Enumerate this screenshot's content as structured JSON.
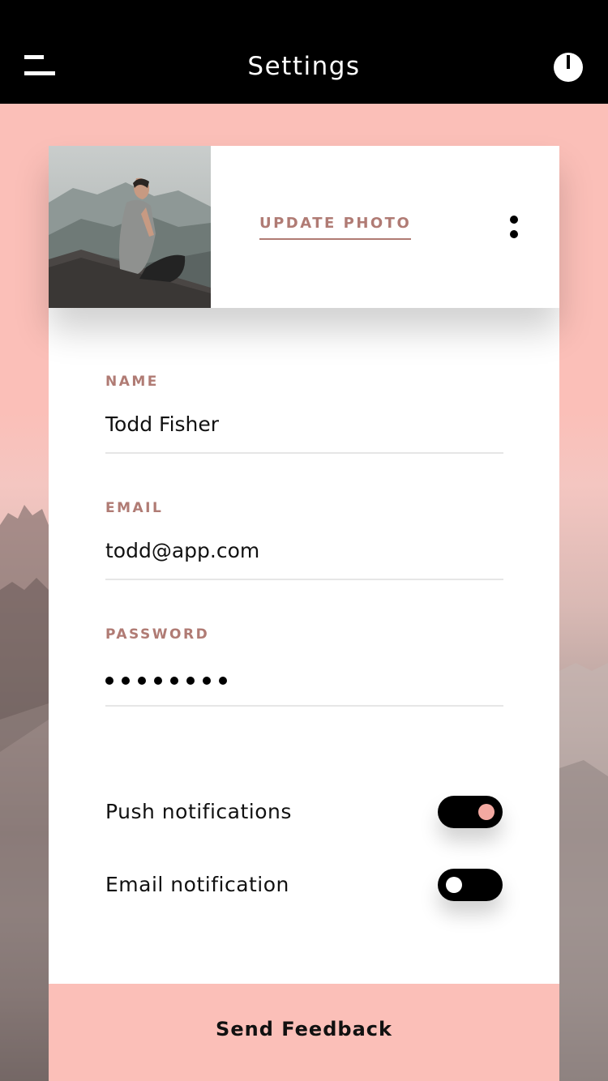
{
  "header": {
    "title": "Settings",
    "menu_icon": "menu-icon",
    "power_icon": "power-icon"
  },
  "profile": {
    "update_photo_label": "UPDATE PHOTO",
    "more_icon": "more-vertical-icon"
  },
  "form": {
    "name": {
      "label": "NAME",
      "value": "Todd Fisher"
    },
    "email": {
      "label": "EMAIL",
      "value": "todd@app.com"
    },
    "password": {
      "label": "PASSWORD",
      "masked_length": 8
    }
  },
  "toggles": {
    "push": {
      "label": "Push notifications",
      "on": true
    },
    "email": {
      "label": "Email notification",
      "on": false
    }
  },
  "footer": {
    "feedback_label": "Send Feedback"
  },
  "colors": {
    "accent": "#fbbfb8",
    "label": "#b07b74",
    "toggle_on_knob": "#f3a9a1"
  }
}
